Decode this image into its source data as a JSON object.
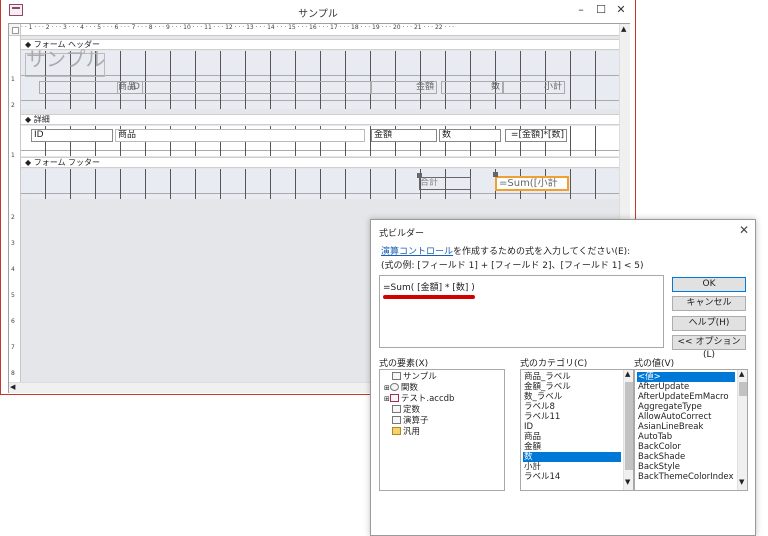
{
  "window": {
    "title": "サンプル",
    "minimize": "–",
    "maximize": "☐",
    "close": "✕"
  },
  "ruler": {
    "h": "· · 1 · · · 2 · · · 3 · · · 4 · · · 5 · · · 6 · · · 7 · · · 8 · · · 9 · · · 10 · · · 11 · · · 12 · · · 13 · · · 14 · · · 15 · · · 16 · · · 17 · · · 18 · · · 19 · · · 20 · · · 21 · · · 22 · · ·"
  },
  "sections": {
    "header": "フォーム ヘッダー",
    "detail": "詳細",
    "footer": "フォーム フッター"
  },
  "header_controls": {
    "logo": "サンプル",
    "id": "ID",
    "product": "商品",
    "amount": "金額",
    "qty": "数",
    "subtotal": "小計"
  },
  "detail_controls": {
    "id": "ID",
    "product": "商品",
    "amount": "金額",
    "qty": "数",
    "subtotal_expr": "=[金額]*[数]"
  },
  "footer_controls": {
    "total_label": "合計",
    "sum_expr": "=Sum([小計"
  },
  "dialog": {
    "title": "式ビルダー",
    "close": "✕",
    "instruction_link": "演算コントロール",
    "instruction_rest": "を作成するための式を入力してください(E):",
    "example": "(式の例: [フィールド 1] + [フィールド 2]、[フィールド 1] < 5)",
    "expression": "=Sum( [金額] * [数] )",
    "buttons": {
      "ok": "OK",
      "cancel": "キャンセル",
      "help": "ヘルプ(H)",
      "options": "<< オプション(L)"
    },
    "panels": {
      "elements_label": "式の要素(X)",
      "categories_label": "式のカテゴリ(C)",
      "values_label": "式の値(V)"
    },
    "elements": [
      "サンプル",
      "関数",
      "テスト.accdb",
      "定数",
      "演算子",
      "汎用"
    ],
    "categories": [
      "商品_ラベル",
      "金額_ラベル",
      "数_ラベル",
      "ラベル8",
      "ラベル11",
      "ID",
      "商品",
      "金額",
      "数",
      "小計",
      "ラベル14"
    ],
    "selected_category": "数",
    "values": [
      "<値>",
      "AfterUpdate",
      "AfterUpdateEmMacro",
      "AggregateType",
      "AllowAutoCorrect",
      "AsianLineBreak",
      "AutoTab",
      "BackColor",
      "BackShade",
      "BackStyle",
      "BackThemeColorIndex"
    ],
    "selected_value": "<値>"
  }
}
